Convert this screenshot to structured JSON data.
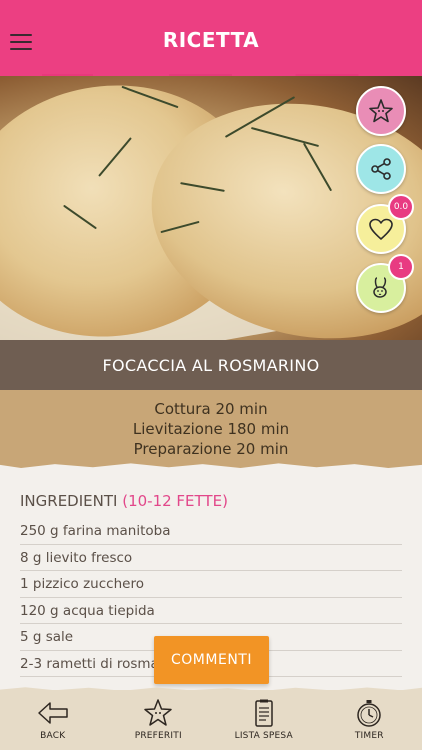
{
  "header": {
    "title": "RICETTA",
    "menu_icon": "hamburger-menu-icon"
  },
  "colors": {
    "header": "#ec3f82",
    "title_band": "#6f5e52",
    "times_band": "#c8a677",
    "comments_button": "#f29425",
    "badge": "#e83b82"
  },
  "actions": {
    "star_icon": "star-icon",
    "share_icon": "share-icon",
    "heart_icon": "heart-icon",
    "heart_badge": "0.0",
    "rabbit_icon": "rabbit-icon",
    "rabbit_badge": "1"
  },
  "recipe": {
    "title": "FOCACCIA AL ROSMARINO",
    "times": [
      "Cottura 20 min",
      "Lievitazione 180 min",
      "Preparazione 20 min"
    ]
  },
  "ingredients": {
    "heading": "INGREDIENTI",
    "yield": "(10-12 FETTE)",
    "items": [
      "250 g farina manitoba",
      "8 g lievito fresco",
      "1 pizzico zucchero",
      "120 g acqua tiepida",
      "5 g sale",
      "2-3 rametti di rosmarino"
    ]
  },
  "comments_button": "COMMENTI",
  "bottom_nav": [
    {
      "label": "BACK",
      "icon": "back-arrow-icon"
    },
    {
      "label": "PREFERITI",
      "icon": "star-icon"
    },
    {
      "label": "LISTA SPESA",
      "icon": "shopping-list-icon"
    },
    {
      "label": "TIMER",
      "icon": "timer-icon"
    }
  ]
}
